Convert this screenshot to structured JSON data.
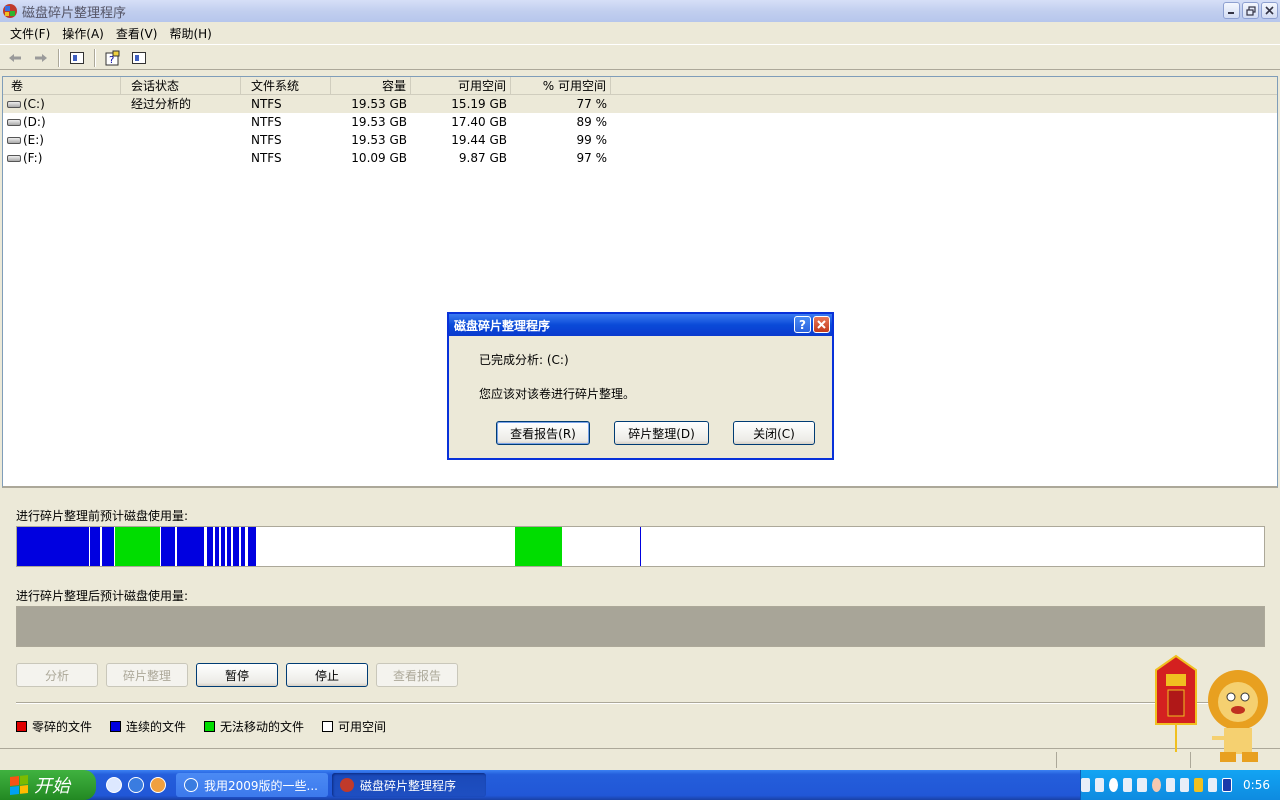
{
  "window": {
    "title": "磁盘碎片整理程序"
  },
  "menu": [
    "文件(F)",
    "操作(A)",
    "查看(V)",
    "帮助(H)"
  ],
  "toolbar": {
    "icons": [
      "back-arrow-icon",
      "forward-arrow-icon",
      "show-hide-console-tree-icon",
      "help-icon",
      "properties-icon"
    ]
  },
  "volumes": {
    "columns": [
      "卷",
      "会话状态",
      "文件系统",
      "容量",
      "可用空间",
      "% 可用空间"
    ],
    "rows": [
      {
        "vol": "(C:)",
        "status": "经过分析的",
        "fs": "NTFS",
        "capacity": "19.53 GB",
        "free": "15.19 GB",
        "pct": "77 %"
      },
      {
        "vol": "(D:)",
        "status": "",
        "fs": "NTFS",
        "capacity": "19.53 GB",
        "free": "17.40 GB",
        "pct": "89 %"
      },
      {
        "vol": "(E:)",
        "status": "",
        "fs": "NTFS",
        "capacity": "19.53 GB",
        "free": "19.44 GB",
        "pct": "99 %"
      },
      {
        "vol": "(F:)",
        "status": "",
        "fs": "NTFS",
        "capacity": "10.09 GB",
        "free": "9.87 GB",
        "pct": "97 %"
      }
    ]
  },
  "usage": {
    "before_label": "进行碎片整理前预计磁盘使用量:",
    "after_label": "进行碎片整理后预计磁盘使用量:"
  },
  "buttons": {
    "analyze": "分析",
    "defrag": "碎片整理",
    "pause": "暂停",
    "stop": "停止",
    "view_report": "查看报告"
  },
  "legend": [
    {
      "label": "零碎的文件",
      "color": "#E00000"
    },
    {
      "label": "连续的文件",
      "color": "#0000E0"
    },
    {
      "label": "无法移动的文件",
      "color": "#00DD00"
    },
    {
      "label": "可用空间",
      "color": "#FFFFFF"
    }
  ],
  "dialog": {
    "title": "磁盘碎片整理程序",
    "line1": "已完成分析: (C:)",
    "line2": "您应该对该卷进行碎片整理。",
    "btn_report": "查看报告(R)",
    "btn_defrag": "碎片整理(D)",
    "btn_close": "关闭(C)"
  },
  "taskbar": {
    "start": "开始",
    "tasks": [
      "我用2009版的一些...",
      "磁盘碎片整理程序"
    ],
    "clock": "0:56"
  },
  "colors": {
    "accent": "#0A3ACE",
    "taskbar": "#245EDB",
    "start": "#2F9A2F"
  }
}
